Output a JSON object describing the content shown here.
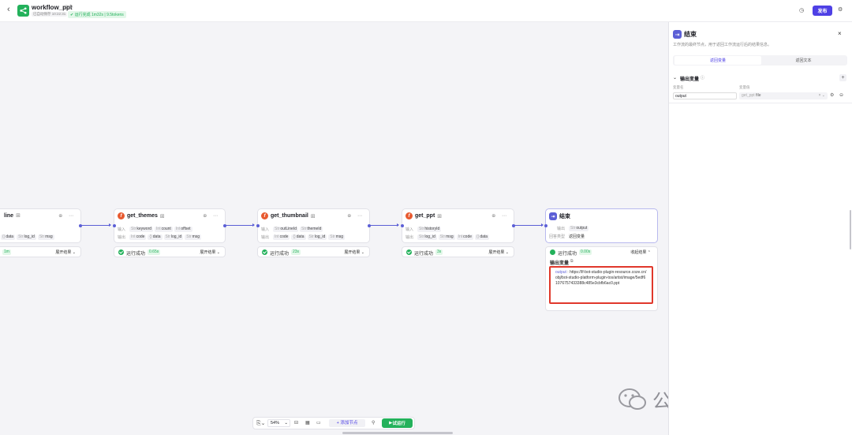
{
  "header": {
    "back": "‹",
    "title": "workflow_ppt",
    "autosave": "已自动保存 10:22:31",
    "run_status": "运行完成 1m32s | 9.5tokens",
    "publish": "发布"
  },
  "nodes": [
    {
      "name": "line",
      "input_tags": [],
      "output_tags": [
        {
          "t": "{}",
          "v": "data"
        },
        {
          "t": "Str",
          "v": "log_id"
        },
        {
          "t": "Str",
          "v": "msg"
        }
      ],
      "status": "",
      "time": "1m",
      "more": "展开结果"
    },
    {
      "name": "get_themes",
      "input_tags": [
        {
          "t": "Str",
          "v": "keyword"
        },
        {
          "t": "Int",
          "v": "count"
        },
        {
          "t": "Int",
          "v": "offset"
        }
      ],
      "output_tags": [
        {
          "t": "Int",
          "v": "code"
        },
        {
          "t": "{}",
          "v": "data"
        },
        {
          "t": "Str",
          "v": "log_id"
        },
        {
          "t": "Str",
          "v": "msg"
        }
      ],
      "status": "运行成功",
      "time": "0.65s",
      "more": "展开结果"
    },
    {
      "name": "get_thumbnail",
      "input_tags": [
        {
          "t": "Str",
          "v": "outLineId"
        },
        {
          "t": "Str",
          "v": "themeId"
        }
      ],
      "output_tags": [
        {
          "t": "Int",
          "v": "code"
        },
        {
          "t": "{}",
          "v": "data"
        },
        {
          "t": "Str",
          "v": "log_id"
        },
        {
          "t": "Str",
          "v": "msg"
        }
      ],
      "status": "运行成功",
      "time": "23s",
      "more": "展开结果"
    },
    {
      "name": "get_ppt",
      "input_tags": [
        {
          "t": "Str",
          "v": "historyId"
        }
      ],
      "output_tags": [
        {
          "t": "Str",
          "v": "log_id"
        },
        {
          "t": "Str",
          "v": "msg"
        },
        {
          "t": "Int",
          "v": "code"
        },
        {
          "t": "{}",
          "v": "data"
        }
      ],
      "status": "运行成功",
      "time": "3s",
      "more": "展开结果"
    }
  ],
  "labels": {
    "input": "输入",
    "output": "输出"
  },
  "end_node": {
    "title": "结束",
    "out_label": "输出",
    "out_tag": "output",
    "type_label": "回答类型",
    "type_value": "返回变量",
    "status": "运行成功",
    "time": "0.00s",
    "collapse": "收起结果",
    "result_label": "输出变量",
    "result_key": "output",
    "result_value": "https://lf-bot-studio-plugin-resource.coze.cn/obj/bot-studio-platform-plugin-tos/artist/image/5edf61076757433388c485e3cbfb6ac0.ppt"
  },
  "panel": {
    "title": "结束",
    "desc": "工作流的最终节点，用于返回工作流运行后的结果信息。",
    "tab1": "返回变量",
    "tab2": "返回文本",
    "section": "输出变量",
    "col_name": "变量名",
    "col_value": "变量值",
    "var_name": "output",
    "var_src": "get_ppt",
    "var_field": "file"
  },
  "toolbar": {
    "zoom": "54%",
    "add_node": "添加节点",
    "test_run": "试运行"
  },
  "watermark": "公众号 · 斜杠君",
  "colors": {
    "accent": "#4e40e5",
    "success": "#23b15b",
    "edge": "#5c5fd6",
    "highlight": "#e0382b"
  }
}
